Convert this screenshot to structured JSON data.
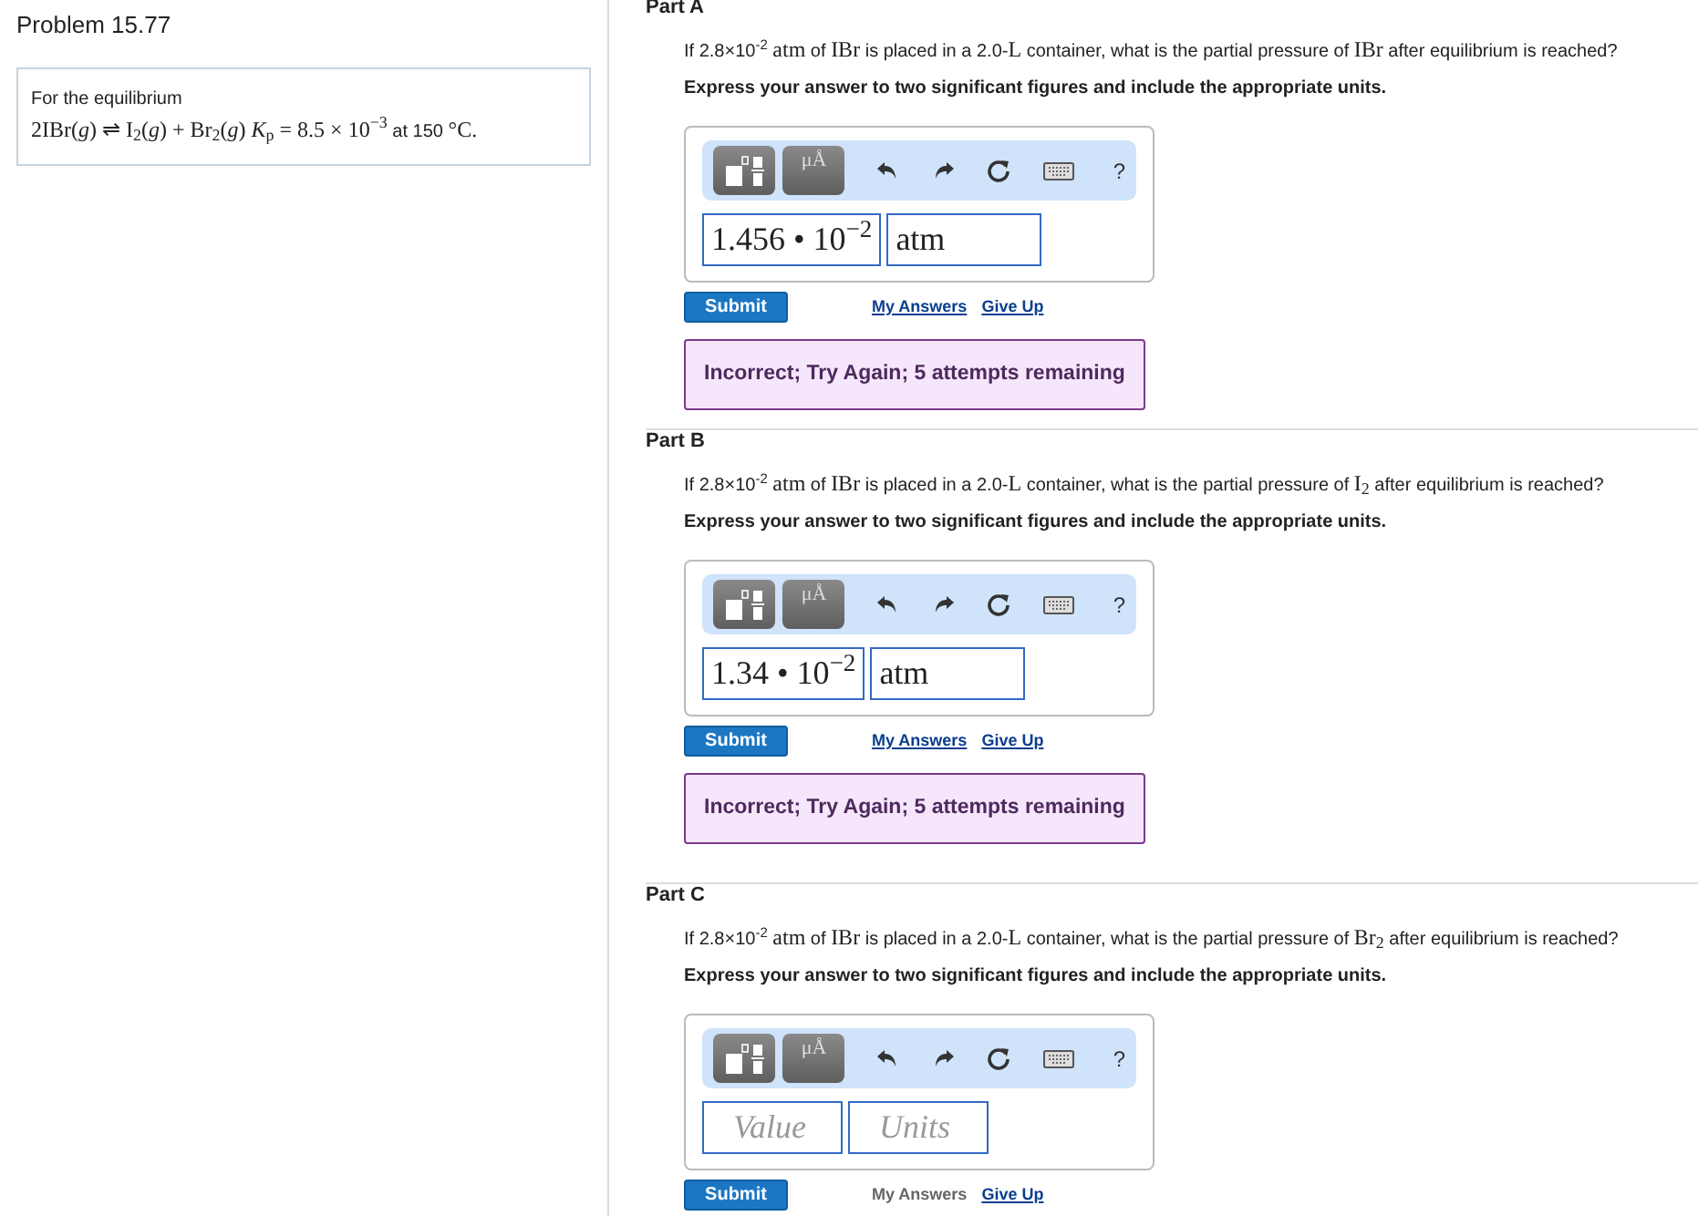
{
  "problem": {
    "title": "Problem 15.77",
    "intro": "For the equilibrium",
    "equation": [
      {
        "kind": "math",
        "text": "2IBr(*g*) ⇌ I$_{2}$(*g*) + Br$_{2}$(*g*) *K*$_{p}$ = 8.5 × 10$^{−3}$"
      },
      {
        "kind": "text",
        "text": " at 150 "
      },
      {
        "kind": "math",
        "text": "°C."
      }
    ]
  },
  "parts": [
    {
      "title": "Part A",
      "question": [
        {
          "kind": "text",
          "text": "If 2.8×10$^{-2}$ "
        },
        {
          "kind": "math",
          "text": "atm"
        },
        {
          "kind": "text",
          "text": " of "
        },
        {
          "kind": "math",
          "text": "IBr"
        },
        {
          "kind": "text",
          "text": " is placed in a 2.0-"
        },
        {
          "kind": "math",
          "text": "L"
        },
        {
          "kind": "text",
          "text": " container, what is the partial pressure of "
        },
        {
          "kind": "math",
          "text": "IBr"
        },
        {
          "kind": "text",
          "text": " after equilibrium is reached?"
        }
      ],
      "instruction": "Express your answer to two significant figures and include the appropriate units.",
      "toolbar": {
        "units_button": "μÅ",
        "help": "?"
      },
      "value": {
        "value": "1.456 • 10$^{−2}$"
      },
      "units": {
        "value": "atm"
      },
      "submit": "Submit",
      "my_answers": {
        "label": "My Answers",
        "disabled": false
      },
      "give_up": "Give Up",
      "feedback": {
        "kind": "incorrect",
        "text": "Incorrect; Try Again; 5 attempts remaining"
      }
    },
    {
      "title": "Part B",
      "question": [
        {
          "kind": "text",
          "text": "If 2.8×10$^{-2}$ "
        },
        {
          "kind": "math",
          "text": "atm"
        },
        {
          "kind": "text",
          "text": " of "
        },
        {
          "kind": "math",
          "text": "IBr"
        },
        {
          "kind": "text",
          "text": " is placed in a 2.0-"
        },
        {
          "kind": "math",
          "text": "L"
        },
        {
          "kind": "text",
          "text": " container, what is the partial pressure of "
        },
        {
          "kind": "math",
          "text": "I$_{2}$"
        },
        {
          "kind": "text",
          "text": " after equilibrium is reached?"
        }
      ],
      "instruction": "Express your answer to two significant figures and include the appropriate units.",
      "toolbar": {
        "units_button": "μÅ",
        "help": "?"
      },
      "value": {
        "value": "1.34 • 10$^{−2}$"
      },
      "units": {
        "value": "atm"
      },
      "submit": "Submit",
      "my_answers": {
        "label": "My Answers",
        "disabled": false
      },
      "give_up": "Give Up",
      "feedback": {
        "kind": "incorrect",
        "text": "Incorrect; Try Again; 5 attempts remaining"
      }
    },
    {
      "title": "Part C",
      "question": [
        {
          "kind": "text",
          "text": "If 2.8×10$^{-2}$ "
        },
        {
          "kind": "math",
          "text": "atm"
        },
        {
          "kind": "text",
          "text": " of "
        },
        {
          "kind": "math",
          "text": "IBr"
        },
        {
          "kind": "text",
          "text": " is placed in a 2.0-"
        },
        {
          "kind": "math",
          "text": "L"
        },
        {
          "kind": "text",
          "text": " container, what is the partial pressure of "
        },
        {
          "kind": "math",
          "text": "Br$_{2}$"
        },
        {
          "kind": "text",
          "text": " after equilibrium is reached?"
        }
      ],
      "instruction": "Express your answer to two significant figures and include the appropriate units.",
      "toolbar": {
        "units_button": "μÅ",
        "help": "?"
      },
      "value": {
        "placeholder": "Value"
      },
      "units": {
        "placeholder": "Units"
      },
      "submit": "Submit",
      "my_answers": {
        "label": "My Answers",
        "disabled": true
      },
      "give_up": "Give Up"
    }
  ]
}
